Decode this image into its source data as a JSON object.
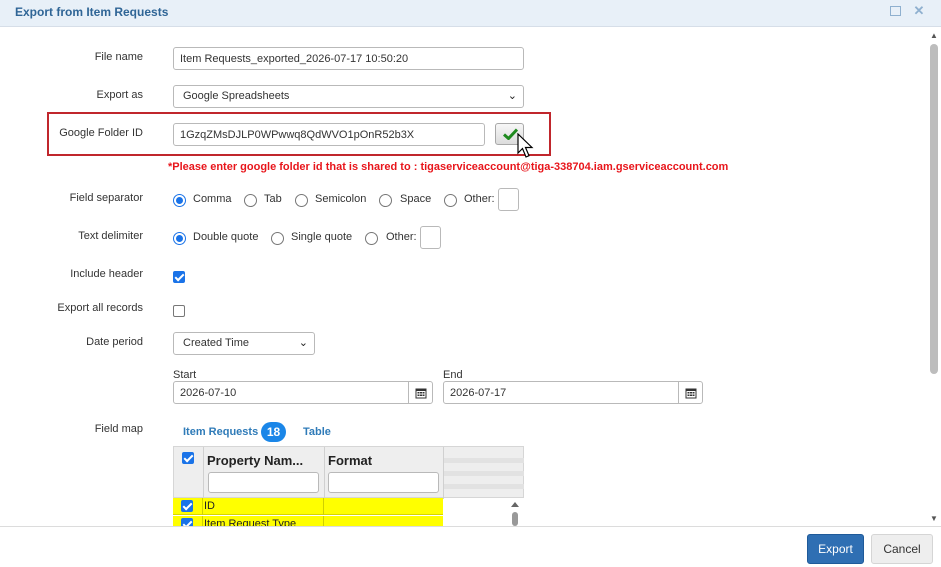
{
  "dialog": {
    "title": "Export from Item Requests"
  },
  "form": {
    "file_name_label": "File name",
    "file_name_value": "Item Requests_exported_2026-07-17 10:50:20",
    "export_as_label": "Export as",
    "export_as_value": "Google Spreadsheets",
    "google_folder_label": "Google Folder ID",
    "google_folder_value": "1GzqZMsDJLP0WPwwq8QdWVO1pOnR52b3X",
    "warning": "*Please enter google folder id that is shared to : tigaserviceaccount@tiga-338704.iam.gserviceaccount.com",
    "field_separator_label": "Field separator",
    "field_separator_options": [
      "Comma",
      "Tab",
      "Semicolon",
      "Space",
      "Other:"
    ],
    "field_separator_selected": "Comma",
    "text_delimiter_label": "Text delimiter",
    "text_delimiter_options": [
      "Double quote",
      "Single quote",
      "Other:"
    ],
    "text_delimiter_selected": "Double quote",
    "include_header_label": "Include header",
    "include_header_checked": true,
    "export_all_label": "Export all records",
    "export_all_checked": false,
    "date_period_label": "Date period",
    "date_period_value": "Created Time",
    "start_label": "Start",
    "start_value": "2026-07-10",
    "end_label": "End",
    "end_value": "2026-07-17",
    "field_map_label": "Field map"
  },
  "field_map": {
    "tab_item_requests": "Item Requests",
    "tab_item_requests_count": "18",
    "tab_table": "Table",
    "columns": [
      "Property Nam...",
      "Format"
    ],
    "rows": [
      {
        "checked": true,
        "name": "ID",
        "format": ""
      },
      {
        "checked": true,
        "name": "Item Request Type",
        "format": ""
      }
    ]
  },
  "footer": {
    "export_label": "Export",
    "cancel_label": "Cancel"
  },
  "colors": {
    "accent": "#2f6fb3",
    "warning": "#e8151b",
    "highlight_row": "#ffff00",
    "title": "#2f6596"
  }
}
